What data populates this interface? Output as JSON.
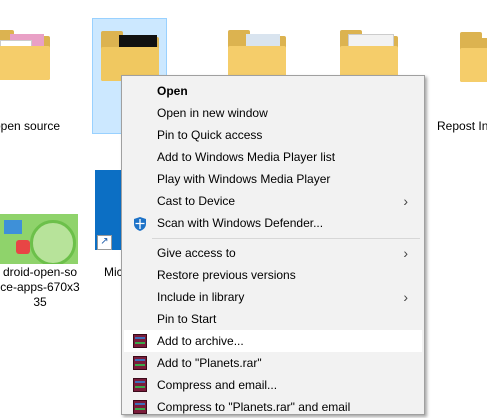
{
  "files": [
    {
      "label": "open source"
    },
    {
      "label": ""
    },
    {
      "label": ""
    },
    {
      "label": ""
    },
    {
      "label": "Repost In"
    },
    {
      "label": "Mic"
    },
    {
      "label_lines": [
        "droid-open-so",
        "ce-apps-670x3",
        "35"
      ]
    }
  ],
  "context_menu": {
    "items": [
      {
        "label": "Open",
        "bold": true,
        "icon": "",
        "submenu": false
      },
      {
        "label": "Open in new window",
        "icon": "",
        "submenu": false
      },
      {
        "label": "Pin to Quick access",
        "icon": "",
        "submenu": false
      },
      {
        "label": "Add to Windows Media Player list",
        "icon": "",
        "submenu": false
      },
      {
        "label": "Play with Windows Media Player",
        "icon": "",
        "submenu": false
      },
      {
        "label": "Cast to Device",
        "icon": "",
        "submenu": true
      },
      {
        "label": "Scan with Windows Defender...",
        "icon": "windows-defender-icon",
        "submenu": false
      },
      {
        "label": "Give access to",
        "icon": "",
        "submenu": true
      },
      {
        "label": "Restore previous versions",
        "icon": "",
        "submenu": false
      },
      {
        "label": "Include in library",
        "icon": "",
        "submenu": true
      },
      {
        "label": "Pin to Start",
        "icon": "",
        "submenu": false
      },
      {
        "label": "Add to archive...",
        "icon": "winrar-icon",
        "submenu": false,
        "highlighted": true
      },
      {
        "label": "Add to \"Planets.rar\"",
        "icon": "winrar-icon",
        "submenu": false
      },
      {
        "label": "Compress and email...",
        "icon": "winrar-icon",
        "submenu": false
      },
      {
        "label": "Compress to \"Planets.rar\" and email",
        "icon": "winrar-icon",
        "submenu": false
      }
    ]
  },
  "colors": {
    "selection_bg": "#cce8ff",
    "menu_bg": "#f2f2f2",
    "folder": "#f5cd6a"
  }
}
